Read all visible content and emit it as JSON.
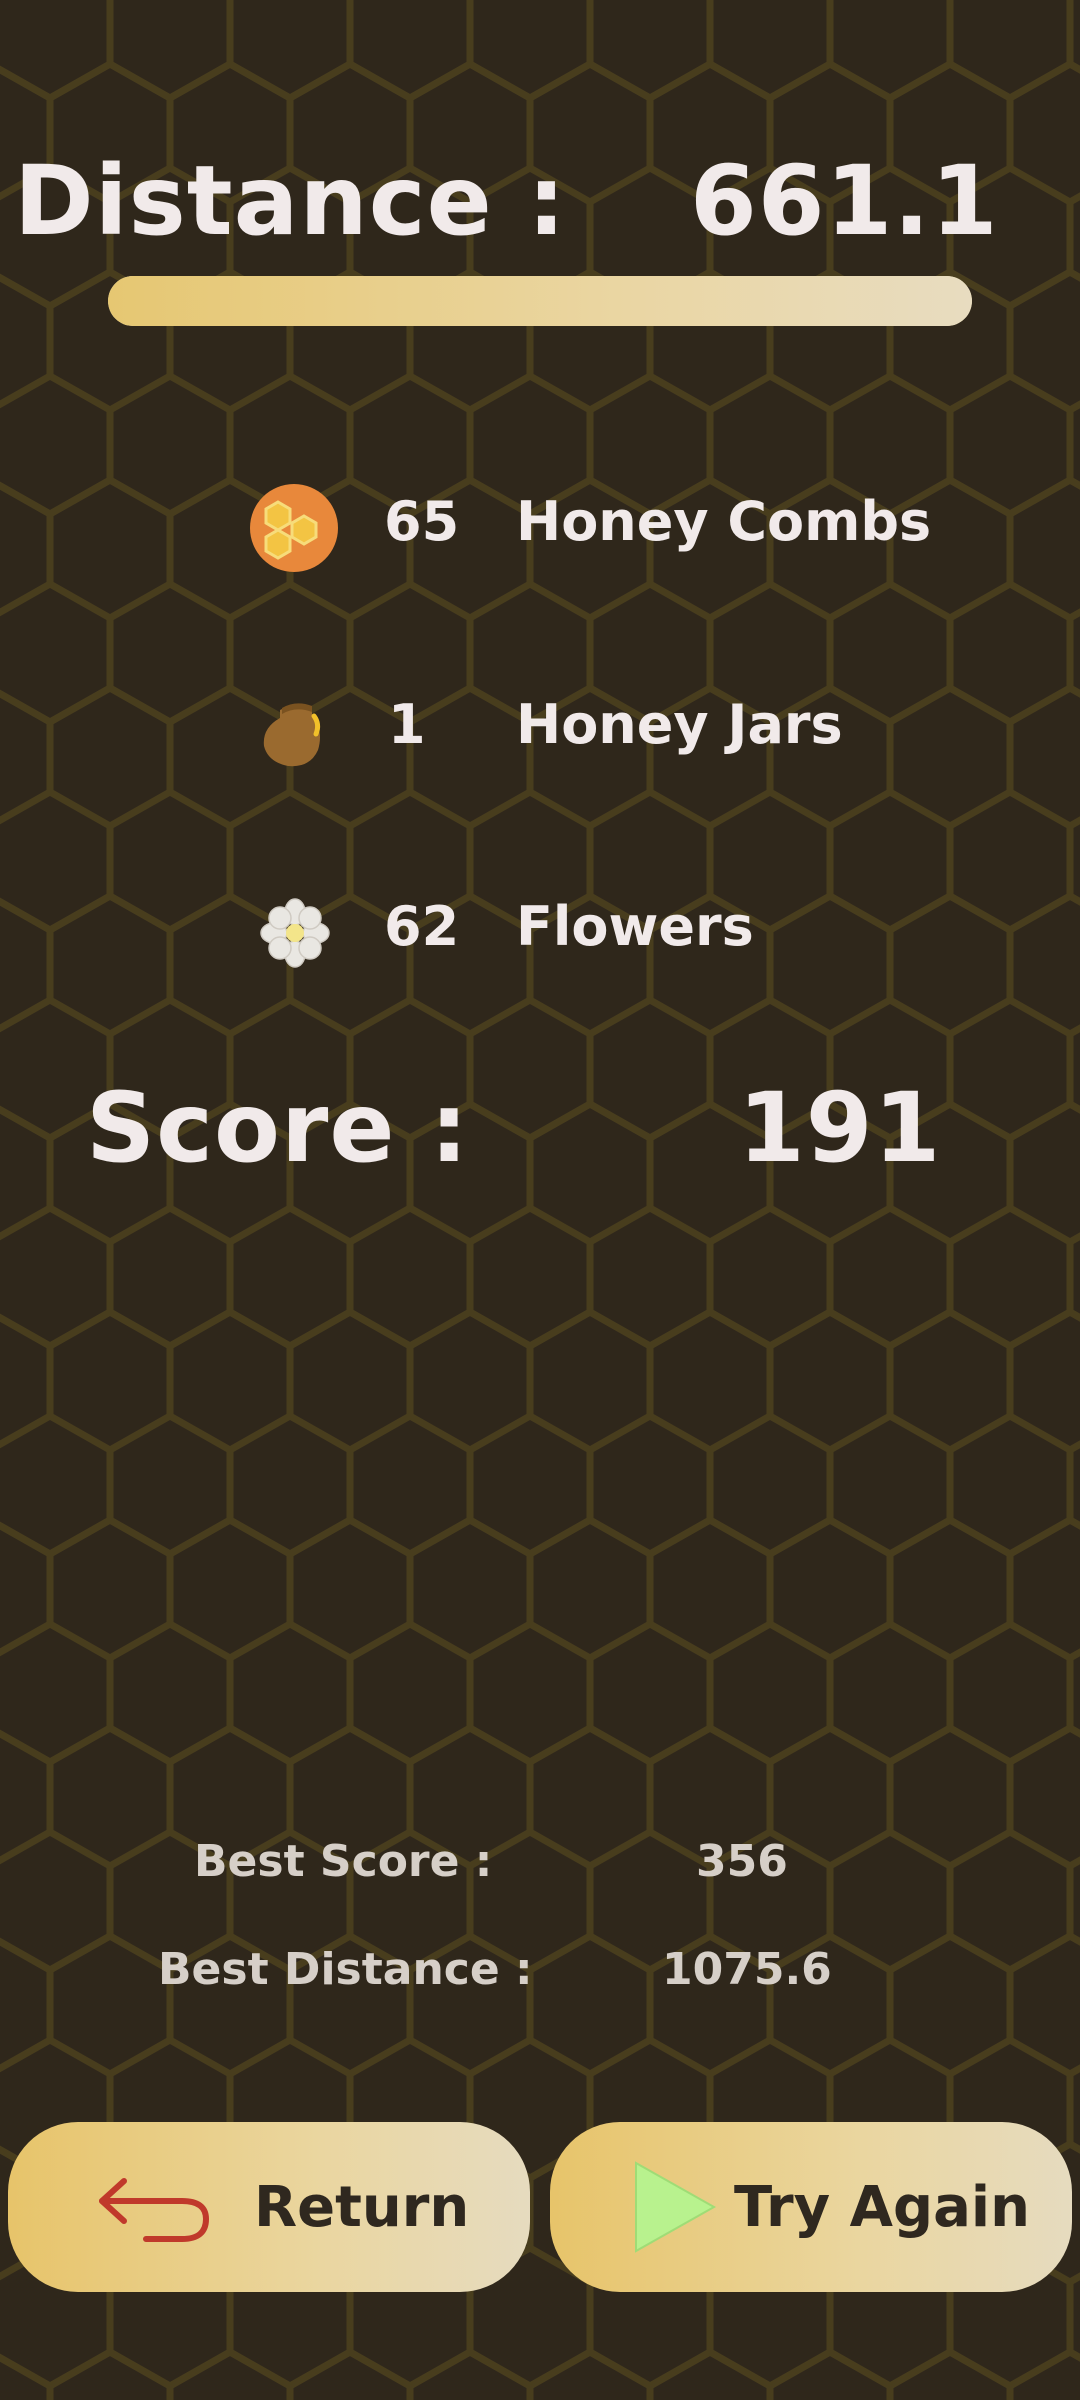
{
  "distance": {
    "label": "Distance :",
    "value": "661.1",
    "progress": 1.0
  },
  "collectibles": [
    {
      "count": "65",
      "label": "Honey Combs",
      "icon": "honeycomb-icon"
    },
    {
      "count": "1",
      "label": "Honey Jars",
      "icon": "honey-jar-icon"
    },
    {
      "count": "62",
      "label": "Flowers",
      "icon": "flower-icon"
    }
  ],
  "score": {
    "label": "Score :",
    "value": "191"
  },
  "best": {
    "score_label": "Best Score :",
    "score_value": "356",
    "distance_label": "Best Distance :",
    "distance_value": "1075.6"
  },
  "buttons": {
    "return_label": "Return",
    "return_icon": "return-arrow-icon",
    "try_again_label": "Try Again",
    "try_again_icon": "play-icon"
  },
  "colors": {
    "background": "#2f271b",
    "hex_line": "#4b3f1d",
    "text": "#f1eaea",
    "button_text": "#2f281f",
    "accent_orange": "#e8883b",
    "return_arrow": "#c0392b",
    "play_green": "#b8f28e"
  }
}
